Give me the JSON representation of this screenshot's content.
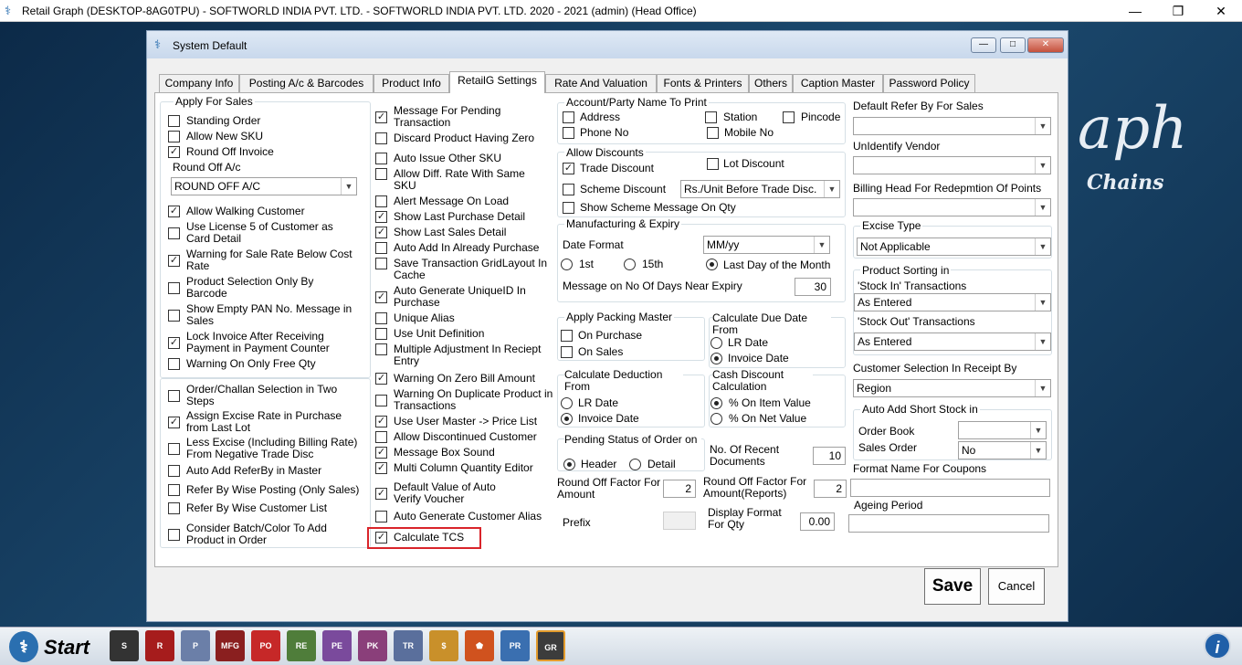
{
  "window": {
    "title": "Retail Graph (DESKTOP-8AG0TPU) - SOFTWORLD INDIA PVT. LTD. - SOFTWORLD INDIA PVT. LTD.  2020 - 2021 (admin) (Head Office)",
    "minimize": "—",
    "restore": "❐",
    "close": "✕"
  },
  "background": {
    "text1": "aph",
    "text2": "Chains"
  },
  "dialog": {
    "title": "System Default",
    "min": "—",
    "max": "□",
    "close": "✕"
  },
  "tabs": [
    "Company Info",
    "Posting A/c & Barcodes",
    "Product Info",
    "RetailG Settings",
    "Rate And Valuation",
    "Fonts & Printers",
    "Others",
    "Caption Master",
    "Password Policy"
  ],
  "col1": {
    "group_title": "Apply For Sales",
    "standing_order": "Standing Order",
    "allow_new_sku": "Allow New SKU",
    "round_off_invoice": "Round Off Invoice",
    "round_off_ac_label": "Round Off A/c",
    "round_off_ac_value": "ROUND OFF A/C",
    "allow_walking": "Allow Walking Customer",
    "use_license": "Use License 5 of Customer as Card Detail",
    "warn_sale_rate": "Warning for Sale Rate Below Cost Rate",
    "product_selection": "Product Selection Only By Barcode",
    "show_empty_pan": "Show Empty PAN No. Message in Sales",
    "lock_invoice": "Lock Invoice After Receiving Payment in Payment Counter",
    "warn_free_qty": "Warning On Only Free Qty",
    "order_challan": "Order/Challan Selection in Two Steps",
    "assign_excise": "Assign Excise Rate in Purchase from Last Lot",
    "less_excise": "Less Excise (Including Billing Rate) From Negative Trade Disc",
    "auto_referby": "Auto Add ReferBy in Master",
    "refer_posting": "Refer By Wise Posting (Only Sales)",
    "refer_list": "Refer By Wise Customer List",
    "consider_batch": "Consider Batch/Color To Add Product in Order"
  },
  "col2": {
    "msg_pending": "Message For Pending Transaction",
    "discard_zero": "Discard Product Having Zero",
    "auto_issue": "Auto Issue Other SKU",
    "allow_diff": "Allow Diff. Rate With Same SKU",
    "alert_load": "Alert Message On Load",
    "show_last_purchase": "Show Last Purchase Detail",
    "show_last_sales": "Show Last Sales Detail",
    "auto_add_purchase": "Auto Add In Already Purchase",
    "save_grid": "Save Transaction GridLayout In Cache",
    "auto_uniqueid": "Auto Generate UniqueID In Purchase",
    "unique_alias": "Unique Alias",
    "use_unit": "Use Unit Definition",
    "multi_adjust": "Multiple Adjustment In Reciept Entry",
    "warn_zero_bill": "Warning On Zero Bill Amount",
    "warn_dup": "Warning On Duplicate Product in Transactions",
    "use_user_master": "Use User Master -> Price List",
    "allow_discontinued": "Allow Discontinued Customer",
    "msgbox_sound": "Message Box Sound",
    "multi_col_qty": "Multi Column Quantity Editor",
    "default_verify": "Default Value of Auto Verify Voucher",
    "auto_cust_alias": "Auto Generate Customer Alias",
    "calc_tcs": "Calculate TCS"
  },
  "col3": {
    "acct_title": "Account/Party Name To Print",
    "address": "Address",
    "station": "Station",
    "pincode": "Pincode",
    "phone": "Phone No",
    "mobile": "Mobile No",
    "disc_title": "Allow Discounts",
    "trade_disc": "Trade Discount",
    "lot_disc": "Lot Discount",
    "scheme_disc": "Scheme Discount",
    "scheme_value": "Rs./Unit Before Trade Disc.",
    "show_scheme": "Show Scheme Message On Qty",
    "mfg_title": "Manufacturing & Expiry",
    "date_format_label": "Date Format",
    "date_format_value": "MM/yy",
    "r_1st": "1st",
    "r_15th": "15th",
    "r_last": "Last  Day of the Month",
    "msg_days_label": "Message on  No Of Days Near Expiry",
    "msg_days_value": "30",
    "packing_title": "Apply Packing Master",
    "on_purchase": "On Purchase",
    "on_sales": "On Sales",
    "due_title": "Calculate Due Date From",
    "lr_date": "LR Date",
    "invoice_date": "Invoice Date",
    "ded_title": "Calculate Deduction From",
    "ded_lr": "LR Date",
    "ded_invoice": "Invoice Date",
    "cash_title": "Cash Discount Calculation",
    "pct_item": "% On Item Value",
    "pct_net": "% On Net Value",
    "pending_title": "Pending Status of Order on",
    "header": "Header",
    "detail": "Detail",
    "recent_docs_label": "No. Of Recent Documents",
    "recent_docs_value": "10",
    "round_amt_label": "Round Off Factor For Amount",
    "round_amt_value": "2",
    "round_rep_label": "Round Off Factor For Amount(Reports)",
    "round_rep_value": "2",
    "prefix_label": "Prefix",
    "disp_fmt_label": "Display Format For Qty",
    "disp_fmt_value": "0.00"
  },
  "col4": {
    "default_refer_label": "Default Refer By For Sales",
    "unidentify_label": "UnIdentify Vendor",
    "billing_head_label": "Billing Head For Redepmtion Of Points",
    "excise_title": "Excise Type",
    "excise_value": "Not Applicable",
    "sorting_title": "Product Sorting in",
    "stock_in_label": "'Stock In' Transactions",
    "stock_in_value": "As Entered",
    "stock_out_label": "'Stock Out' Transactions",
    "stock_out_value": "As Entered",
    "cust_sel_label": "Customer Selection In Receipt By",
    "cust_sel_value": "Region",
    "short_title": "Auto Add Short Stock in",
    "order_book": "Order Book",
    "sales_order": "Sales Order",
    "sales_order_value": "No",
    "coupon_label": "Format Name For Coupons",
    "ageing_label": "Ageing Period"
  },
  "buttons": {
    "save": "Save",
    "cancel": "Cancel"
  },
  "taskbar": {
    "start": "Start",
    "icons": [
      "S",
      "R",
      "P",
      "MFG",
      "PO",
      "RE",
      "PE",
      "PK",
      "TR",
      "$",
      "⬟",
      "PR",
      "GR"
    ],
    "info": "i"
  }
}
